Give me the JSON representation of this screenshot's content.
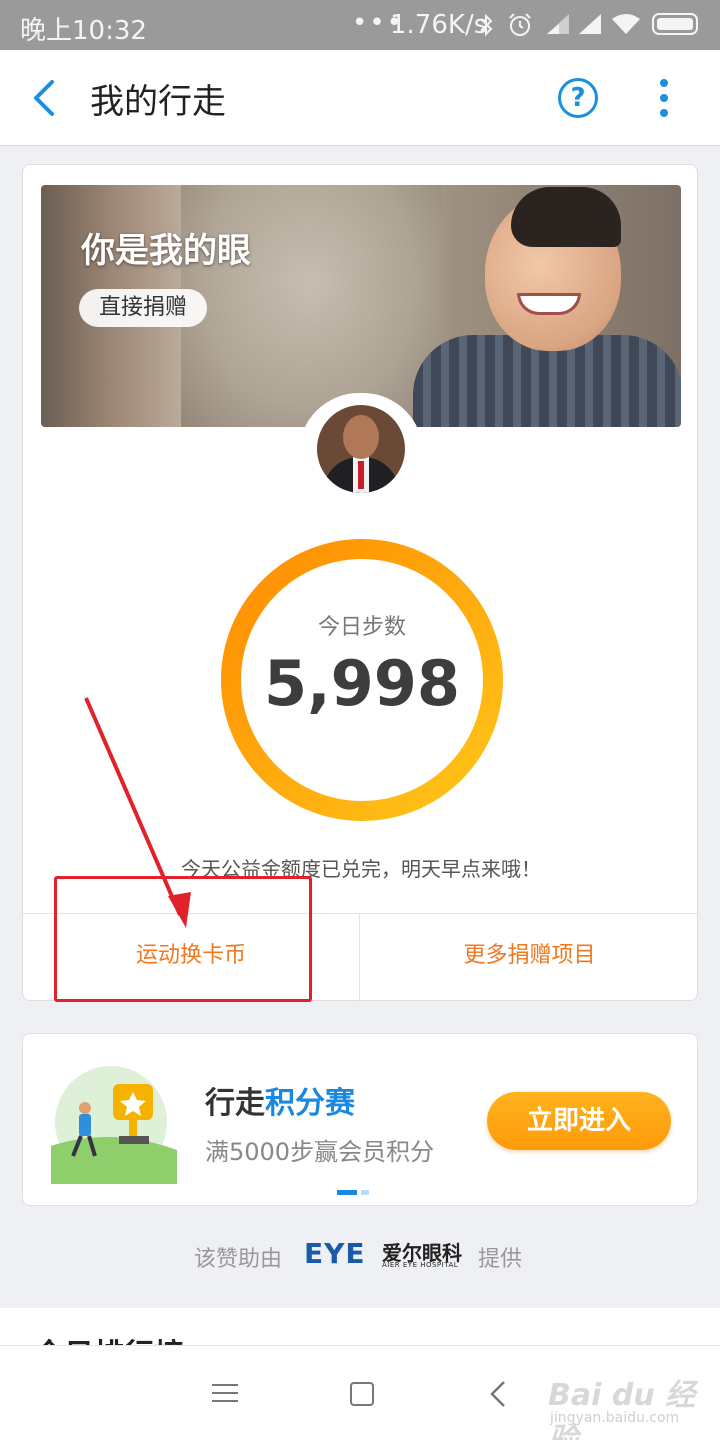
{
  "status_bar": {
    "time": "晚上10:32",
    "dots": "•••",
    "speed": "1.76K/s",
    "icons": [
      "bluetooth-icon",
      "alarm-icon",
      "signal-icon",
      "signal-icon",
      "wifi-icon",
      "battery-icon"
    ]
  },
  "nav": {
    "title": "我的行走",
    "help_label": "?",
    "icons": [
      "back-arrow-icon",
      "help-icon",
      "more-vertical-icon"
    ],
    "accent_color": "#1a8fe0"
  },
  "banner": {
    "title": "你是我的眼",
    "donate_label": "直接捐赠"
  },
  "steps": {
    "label": "今日步数",
    "value": "5,998"
  },
  "notice": "今天公益金额度已兑完，明天早点来哦！",
  "actions": {
    "exchange_label": "运动换卡币",
    "more_label": "更多捐赠项目",
    "color": "#f07820"
  },
  "promo": {
    "title_prefix": "行走",
    "title_highlight": "积分赛",
    "subtitle": "满5000步赢会员积分",
    "button_label": "立即进入"
  },
  "sponsor": {
    "prefix": "该赞助由",
    "logo_mark": "EYE",
    "logo_cn": "爱尔眼科",
    "logo_en": "AIER EYE HOSPITAL",
    "suffix": "提供"
  },
  "ranking": {
    "title": "今日排行榜"
  },
  "watermark": {
    "brand": "Bai du 经验",
    "url": "jingyan.baidu.com"
  }
}
